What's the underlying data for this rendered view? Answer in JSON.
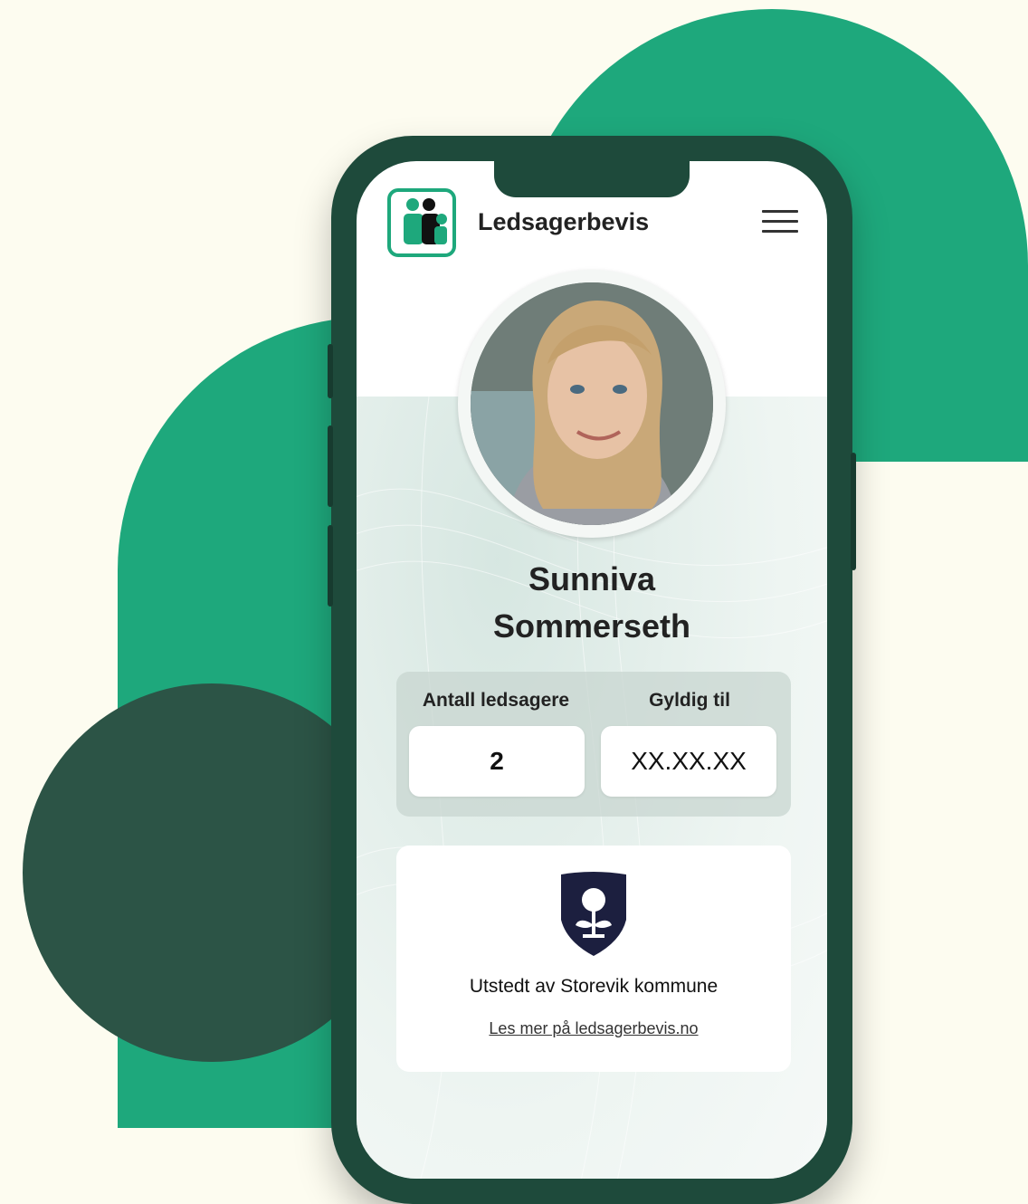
{
  "app": {
    "title": "Ledsagerbevis"
  },
  "holder": {
    "first_name": "Sunniva",
    "last_name": "Sommerseth"
  },
  "card": {
    "companions_label": "Antall ledsagere",
    "companions_value": "2",
    "valid_label": "Gyldig til",
    "valid_value": "XX.XX.XX"
  },
  "issuer": {
    "text": "Utstedt av Storevik kommune",
    "link": "Les mer på ledsagerbevis.no"
  },
  "icons": [
    "companion-logo-icon",
    "hamburger-menu-icon",
    "municipality-crest-icon"
  ],
  "colors": {
    "background": "#fdfcf0",
    "brand_green": "#1ea87c",
    "dark_green": "#2c5446",
    "phone_frame": "#1e4a3b",
    "crest_navy": "#1c1f3f"
  }
}
